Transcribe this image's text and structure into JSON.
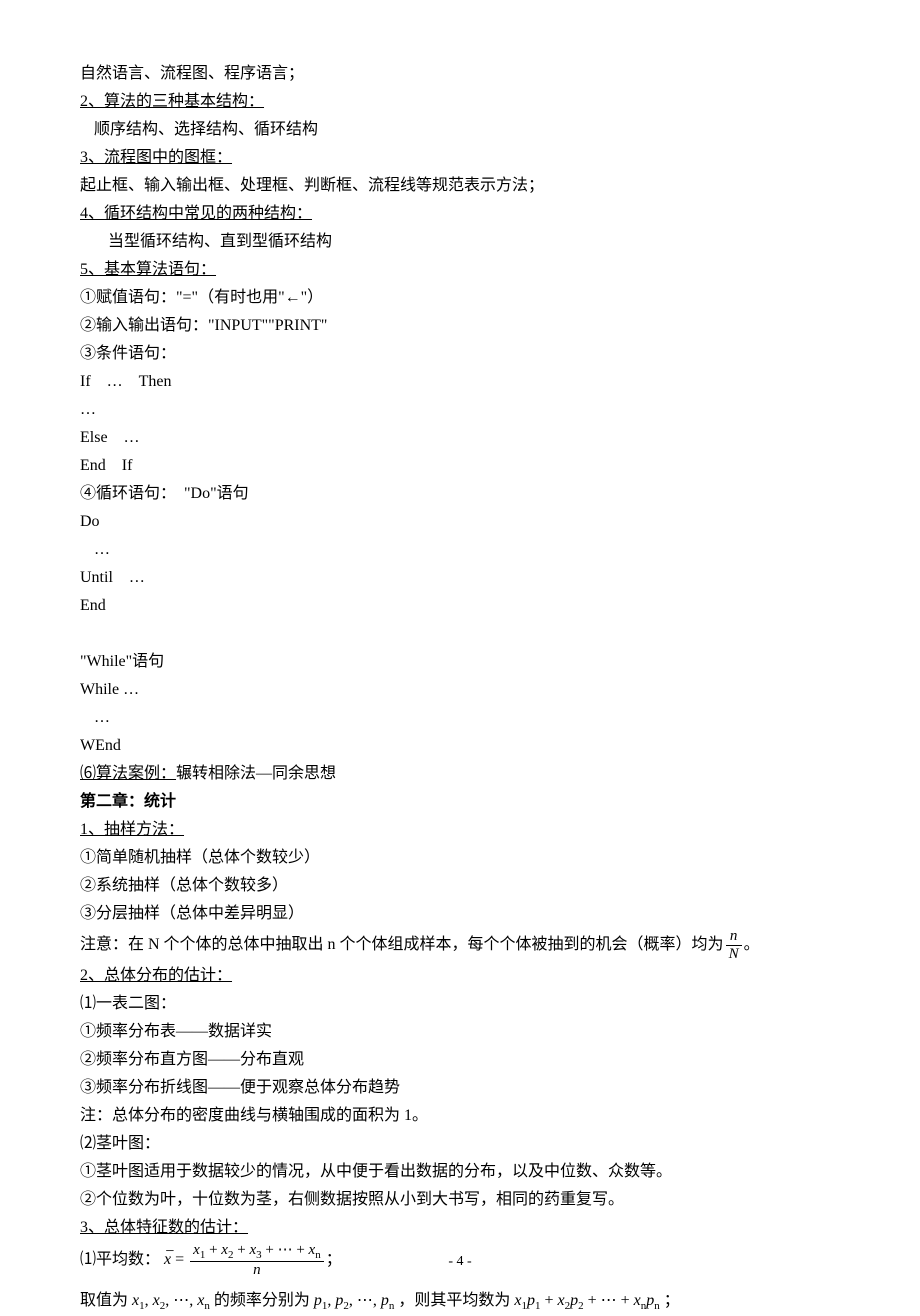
{
  "lines": {
    "l1": "自然语言、流程图、程序语言；",
    "l2": "2、算法的三种基本结构：",
    "l3": "顺序结构、选择结构、循环结构",
    "l4": "3、流程图中的图框：",
    "l5": "起止框、输入输出框、处理框、判断框、流程线等规范表示方法；",
    "l6": "4、循环结构中常见的两种结构：",
    "l7": "当型循环结构、直到型循环结构",
    "l8": "5、基本算法语句：",
    "l9": "①赋值语句：\"=\"（有时也用\"←\"）",
    "l10": "②输入输出语句：\"INPUT\"\"PRINT\"",
    "l11": "③条件语句：",
    "l12": "If　…　Then",
    "l13": "…",
    "l14": "Else　…",
    "l15": "End　If",
    "l16": "④循环语句：　\"Do\"语句",
    "l17": "Do",
    "l18": "…",
    "l19": "Until　…",
    "l20": "End",
    "l21": "\"While\"语句",
    "l22": "While …",
    "l23": "…",
    "l24": "WEnd",
    "l25": "⑹算法案例：",
    "l25b": "辗转相除法—同余思想",
    "l26": "第二章：统计",
    "l27": "1、抽样方法：",
    "l28": "①简单随机抽样（总体个数较少）",
    "l29": "②系统抽样（总体个数较多）",
    "l30": "③分层抽样（总体中差异明显）",
    "l31a": "注意：在 N 个个体的总体中抽取出 n 个个体组成样本，每个个体被抽到的机会（概率）均为",
    "l31b": "。",
    "frac1_num": "n",
    "frac1_den": "N",
    "l32": "2、总体分布的估计：",
    "l33": "⑴一表二图：",
    "l34": "①频率分布表——数据详实",
    "l35": "②频率分布直方图——分布直观",
    "l36": "③频率分布折线图——便于观察总体分布趋势",
    "l37": "注：总体分布的密度曲线与横轴围成的面积为 1。",
    "l38": "⑵茎叶图：",
    "l39": "①茎叶图适用于数据较少的情况，从中便于看出数据的分布，以及中位数、众数等。",
    "l40": "②个位数为叶，十位数为茎，右侧数据按照从小到大书写，相同的药重复写。",
    "l41": "3、总体特征数的估计：",
    "l42a": "⑴平均数：",
    "l42b": "；",
    "frac2_num": "x₁ + x₂ + x₃ + ⋯ + xₙ",
    "frac2_den": "n",
    "l43a": "取值为",
    "l43b": "的频率分别为",
    "l43c": "，则其平均数为",
    "l43d": "；",
    "seq_x": "x₁, x₂, ⋯, xₙ",
    "seq_p": "p₁, p₂, ⋯, pₙ",
    "seq_xp": "x₁p₁ + x₂p₂ + ⋯ + xₙpₙ"
  },
  "page": "- 4 -"
}
